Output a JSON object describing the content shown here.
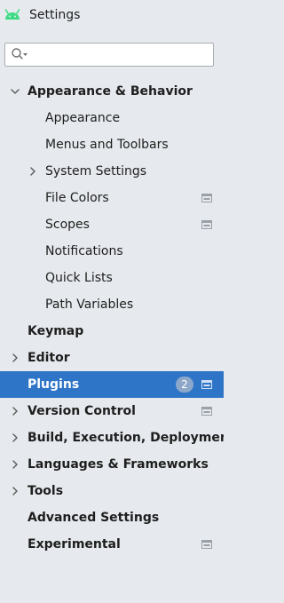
{
  "window": {
    "title": "Settings"
  },
  "search": {
    "placeholder": "",
    "value": ""
  },
  "tree": [
    {
      "label": "Appearance & Behavior",
      "level": 0,
      "bold": true,
      "chevron": "down",
      "project": false
    },
    {
      "label": "Appearance",
      "level": 1,
      "bold": false,
      "chevron": "none",
      "project": false
    },
    {
      "label": "Menus and Toolbars",
      "level": 1,
      "bold": false,
      "chevron": "none",
      "project": false
    },
    {
      "label": "System Settings",
      "level": 1,
      "bold": false,
      "chevron": "right",
      "project": false
    },
    {
      "label": "File Colors",
      "level": 1,
      "bold": false,
      "chevron": "none",
      "project": true
    },
    {
      "label": "Scopes",
      "level": 1,
      "bold": false,
      "chevron": "none",
      "project": true
    },
    {
      "label": "Notifications",
      "level": 1,
      "bold": false,
      "chevron": "none",
      "project": false
    },
    {
      "label": "Quick Lists",
      "level": 1,
      "bold": false,
      "chevron": "none",
      "project": false
    },
    {
      "label": "Path Variables",
      "level": 1,
      "bold": false,
      "chevron": "none",
      "project": false
    },
    {
      "label": "Keymap",
      "level": 0,
      "bold": true,
      "chevron": "none",
      "project": false
    },
    {
      "label": "Editor",
      "level": 0,
      "bold": true,
      "chevron": "right",
      "project": false
    },
    {
      "label": "Plugins",
      "level": 0,
      "bold": true,
      "chevron": "none",
      "project": true,
      "badge": "2",
      "selected": true
    },
    {
      "label": "Version Control",
      "level": 0,
      "bold": true,
      "chevron": "right",
      "project": true
    },
    {
      "label": "Build, Execution, Deployment",
      "level": 0,
      "bold": true,
      "chevron": "right",
      "project": false
    },
    {
      "label": "Languages & Frameworks",
      "level": 0,
      "bold": true,
      "chevron": "right",
      "project": false
    },
    {
      "label": "Tools",
      "level": 0,
      "bold": true,
      "chevron": "right",
      "project": false
    },
    {
      "label": "Advanced Settings",
      "level": 0,
      "bold": true,
      "chevron": "none",
      "project": false
    },
    {
      "label": "Experimental",
      "level": 0,
      "bold": true,
      "chevron": "none",
      "project": true
    }
  ],
  "icons": {
    "app": "android-icon",
    "search": "search-icon",
    "expanded": "chevron-down-icon",
    "collapsed": "chevron-right-icon",
    "project_scope": "project-settings-icon"
  },
  "colors": {
    "background": "#e6e9ed",
    "selection": "#2f75c7",
    "badge": "#8ca7c9",
    "android": "#3ddc84"
  }
}
